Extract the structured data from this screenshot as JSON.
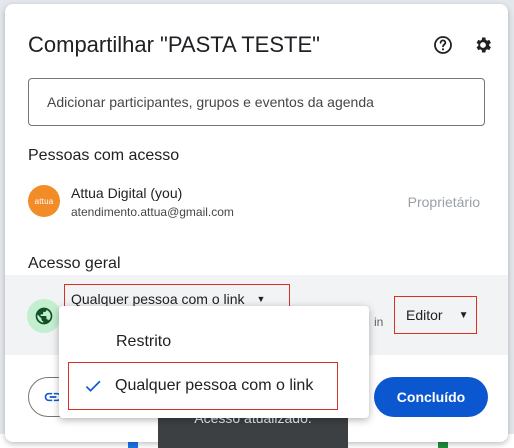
{
  "dialog": {
    "title": "Compartilhar \"PASTA TESTE\"",
    "add_placeholder": "Adicionar participantes, grupos e eventos da agenda"
  },
  "people": {
    "section_title": "Pessoas com acesso",
    "items": [
      {
        "avatar_text": "attua",
        "name": "Attua Digital (you)",
        "email": "atendimento.attua@gmail.com",
        "role": "Proprietário"
      }
    ]
  },
  "general_access": {
    "section_title": "Acesso geral",
    "link_option": "Qualquer pessoa com o link",
    "partial_text": "in",
    "role": "Editor"
  },
  "menu": {
    "options": [
      {
        "label": "Restrito",
        "selected": false
      },
      {
        "label": "Qualquer pessoa com o link",
        "selected": true
      }
    ]
  },
  "footer": {
    "done_label": "Concluído",
    "snackbar": "Acesso atualizado."
  },
  "colors": {
    "primary": "#0b57d0",
    "highlight_box": "#d93025",
    "avatar": "#f28c28",
    "globe_bg": "#c4eed0"
  },
  "icons": [
    "help-icon",
    "gear-icon",
    "globe-icon",
    "link-icon",
    "check-icon",
    "caret-down-icon"
  ]
}
